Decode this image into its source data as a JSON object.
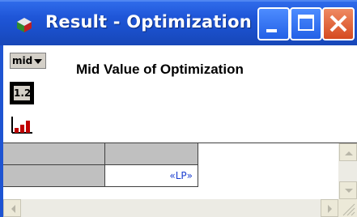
{
  "window": {
    "title": "Result - Optimization",
    "icons": {
      "app": "analytica-cube-icon",
      "minimize": "minimize-icon",
      "maximize": "maximize-icon",
      "close": "close-icon"
    }
  },
  "toolbar": {
    "view_select": {
      "selected": "mid"
    },
    "table_view_label": "1.2",
    "graph_view_icon": "bar-graph-icon"
  },
  "result": {
    "title": "Mid Value of Optimization"
  },
  "grid": {
    "rows": [
      [
        "",
        ""
      ],
      [
        "",
        "«LP»"
      ]
    ]
  },
  "colors": {
    "titlebar": "#1f56d8",
    "close_button": "#d54a20",
    "cell_link_text": "#1a3dd0",
    "grid_header": "#c0c0c0"
  }
}
